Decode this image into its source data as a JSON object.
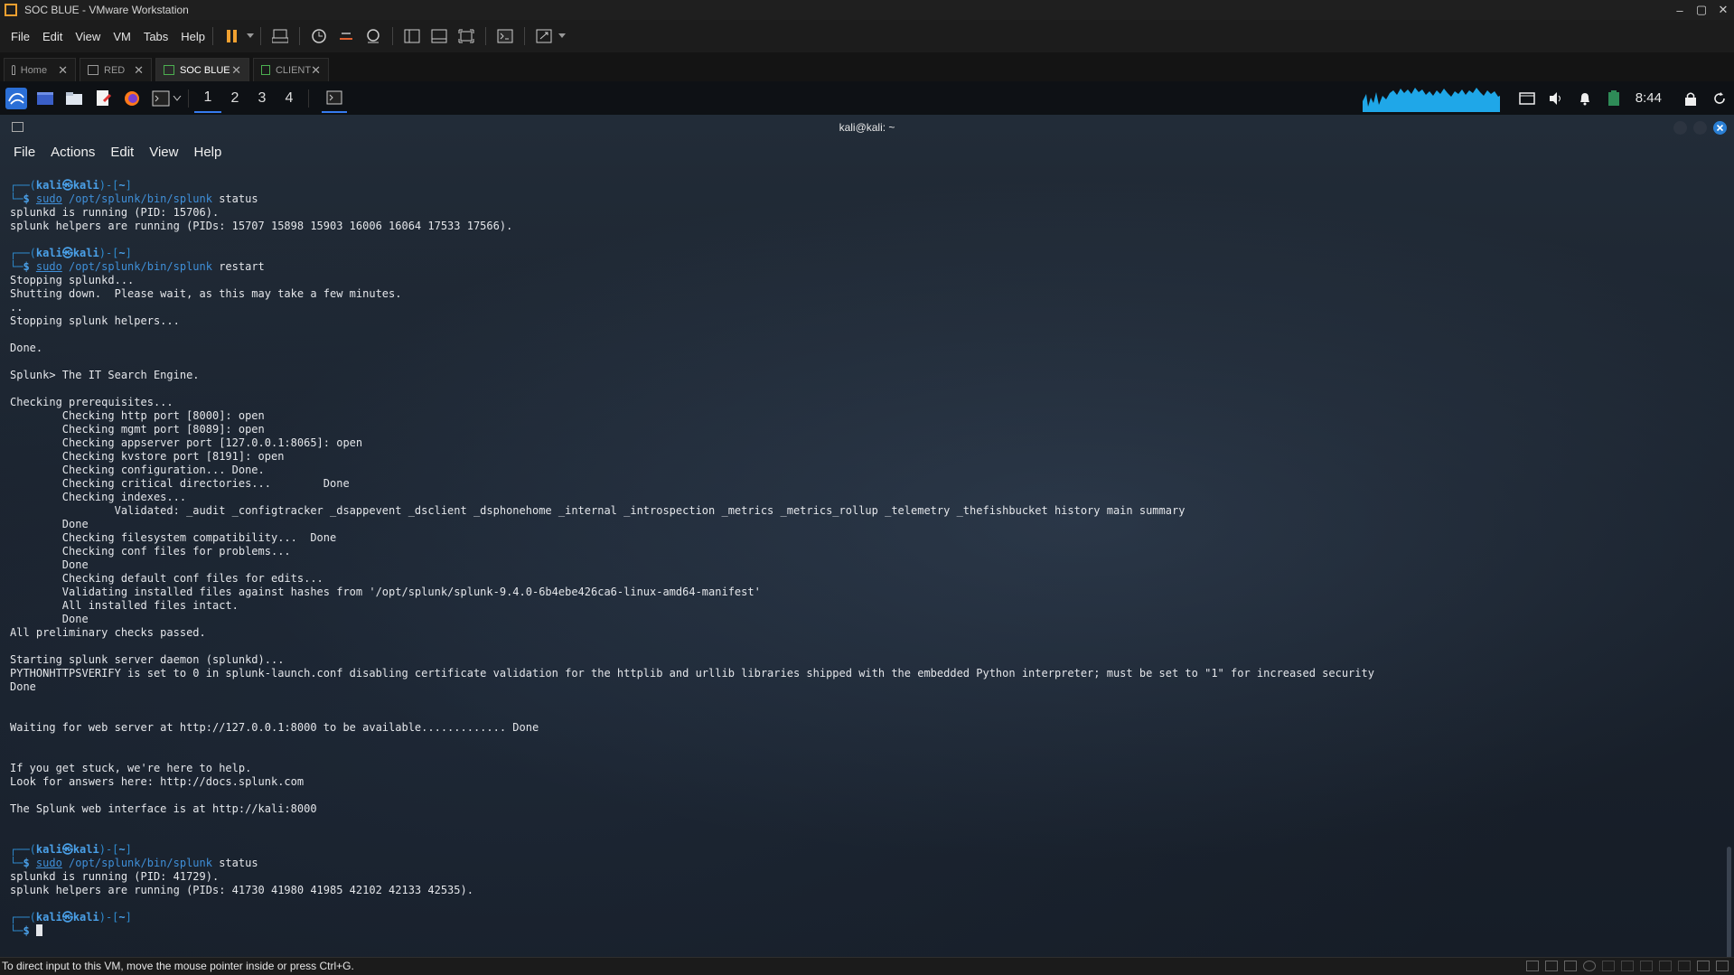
{
  "window": {
    "title": "SOC BLUE - VMware Workstation",
    "minimize": "–",
    "maximize": "▢",
    "close": "✕"
  },
  "vm_menu": {
    "file": "File",
    "edit": "Edit",
    "view": "View",
    "vm": "VM",
    "tabs": "Tabs",
    "help": "Help"
  },
  "vm_tabs": [
    {
      "label": "Home",
      "close": "✕"
    },
    {
      "label": "RED",
      "close": "✕"
    },
    {
      "label": "SOC BLUE",
      "close": "✕"
    },
    {
      "label": "CLIENT",
      "close": "✕"
    }
  ],
  "kali_panel": {
    "workspaces": [
      "1",
      "2",
      "3",
      "4"
    ],
    "clock": "8:44"
  },
  "terminal": {
    "title": "kali@kali: ~",
    "menu": {
      "file": "File",
      "actions": "Actions",
      "edit": "Edit",
      "view": "View",
      "help": "Help"
    },
    "prompt": {
      "top_left": "┌──(",
      "user": "kali",
      "at": "㉿",
      "host": "kali",
      "cwd_open": ")-[",
      "cwd": "~",
      "cwd_close": "]",
      "bottom": "└─",
      "dollar": "$ "
    },
    "cmd_sudo": "sudo",
    "cmd_path": " /opt/splunk/bin/splunk",
    "blocks": [
      {
        "args": " status",
        "output": "splunkd is running (PID: 15706).\nsplunk helpers are running (PIDs: 15707 15898 15903 16006 16064 17533 17566).\n"
      },
      {
        "args": " restart",
        "output": "Stopping splunkd...\nShutting down.  Please wait, as this may take a few minutes.\n..\nStopping splunk helpers...\n\nDone.\n\nSplunk> The IT Search Engine.\n\nChecking prerequisites...\n\tChecking http port [8000]: open\n\tChecking mgmt port [8089]: open\n\tChecking appserver port [127.0.0.1:8065]: open\n\tChecking kvstore port [8191]: open\n\tChecking configuration... Done.\n\tChecking critical directories...\tDone\n\tChecking indexes...\n\t\tValidated: _audit _configtracker _dsappevent _dsclient _dsphonehome _internal _introspection _metrics _metrics_rollup _telemetry _thefishbucket history main summary\n\tDone\n\tChecking filesystem compatibility...  Done\n\tChecking conf files for problems...\n\tDone\n\tChecking default conf files for edits...\n\tValidating installed files against hashes from '/opt/splunk/splunk-9.4.0-6b4ebe426ca6-linux-amd64-manifest'\n\tAll installed files intact.\n\tDone\nAll preliminary checks passed.\n\nStarting splunk server daemon (splunkd)...\nPYTHONHTTPSVERIFY is set to 0 in splunk-launch.conf disabling certificate validation for the httplib and urllib libraries shipped with the embedded Python interpreter; must be set to \"1\" for increased security\nDone\n\n\nWaiting for web server at http://127.0.0.1:8000 to be available............. Done\n\n\nIf you get stuck, we're here to help.\nLook for answers here: http://docs.splunk.com\n\nThe Splunk web interface is at http://kali:8000\n\n"
      },
      {
        "args": " status",
        "output": "splunkd is running (PID: 41729).\nsplunk helpers are running (PIDs: 41730 41980 41985 42102 42133 42535).\n"
      }
    ]
  },
  "status_bar": {
    "message": "To direct input to this VM, move the mouse pointer inside or press Ctrl+G."
  }
}
